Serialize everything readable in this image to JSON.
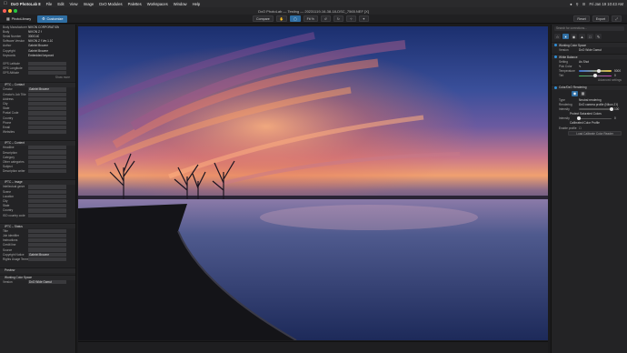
{
  "menubar": {
    "app_name": "DxO PhotoLab 8",
    "items": [
      "File",
      "Edit",
      "View",
      "Image",
      "DxO Modules",
      "Palettes",
      "Workspaces",
      "Window",
      "Help"
    ],
    "clock": "Fri Jan 19  10:43 AM"
  },
  "window": {
    "title": "DxO PhotoLab — Testing — 20231119-16-38-18-DSC_7565.NEF [X]"
  },
  "toolbar": {
    "tabs": [
      {
        "label": "PhotoLibrary",
        "active": false
      },
      {
        "label": "Customize",
        "active": true
      }
    ],
    "compare_label": "Compare",
    "zoom_label": "Fit %",
    "reset_label": "Reset",
    "export_label": "Export"
  },
  "left_panel": {
    "meta_rows": [
      {
        "key": "Body Manufacturer",
        "value": "NIKON CORPORATION"
      },
      {
        "key": "Body",
        "value": "NIKON Z f"
      },
      {
        "key": "Serial Number",
        "value": "3000140"
      },
      {
        "key": "Software Version",
        "value": "NIKON Z f Ver.1.10"
      },
      {
        "key": "Author",
        "value": "Gabriel Browne"
      },
      {
        "key": "Copyright",
        "value": "Gabriel Browne"
      },
      {
        "key": "Keywords",
        "value": "Embedded keyword"
      }
    ],
    "gps_rows": [
      {
        "key": "GPS Latitude",
        "value": ""
      },
      {
        "key": "GPS Longitude",
        "value": ""
      },
      {
        "key": "GPS Altitude",
        "value": ""
      }
    ],
    "show_more_label": "Show more",
    "sections": [
      {
        "title": "IPTC – Contact",
        "rows": [
          {
            "key": "Creator",
            "value": "Gabriel Browne"
          },
          {
            "key": "Creator's Job Title",
            "value": ""
          },
          {
            "key": "Address",
            "value": ""
          },
          {
            "key": "City",
            "value": ""
          },
          {
            "key": "State",
            "value": ""
          },
          {
            "key": "Postal Code",
            "value": ""
          },
          {
            "key": "Country",
            "value": ""
          },
          {
            "key": "Phone",
            "value": ""
          },
          {
            "key": "Email",
            "value": ""
          },
          {
            "key": "Websites",
            "value": ""
          }
        ]
      },
      {
        "title": "IPTC – Content",
        "rows": [
          {
            "key": "Headline",
            "value": ""
          },
          {
            "key": "Description",
            "value": ""
          },
          {
            "key": "Category",
            "value": ""
          },
          {
            "key": "Other categories",
            "value": ""
          },
          {
            "key": "Subject",
            "value": ""
          },
          {
            "key": "Description writer",
            "value": ""
          }
        ]
      },
      {
        "title": "IPTC – Image",
        "rows": [
          {
            "key": "Intellectual genre",
            "value": ""
          },
          {
            "key": "Scene",
            "value": ""
          },
          {
            "key": "Location",
            "value": ""
          },
          {
            "key": "City",
            "value": ""
          },
          {
            "key": "State",
            "value": ""
          },
          {
            "key": "Country",
            "value": ""
          },
          {
            "key": "ISO country code",
            "value": ""
          }
        ]
      },
      {
        "title": "IPTC – Status",
        "rows": [
          {
            "key": "Title",
            "value": ""
          },
          {
            "key": "Job identifier",
            "value": ""
          },
          {
            "key": "Instructions",
            "value": ""
          },
          {
            "key": "Credit line",
            "value": ""
          },
          {
            "key": "Source",
            "value": ""
          },
          {
            "key": "Copyright Notice",
            "value": "Gabriel Browne"
          },
          {
            "key": "Rights Usage Terms",
            "value": ""
          }
        ]
      }
    ],
    "footer_items": [
      "Preview",
      "Working Color Space"
    ],
    "footer_version_key": "Version",
    "footer_version_value": "DxO Wide Gamut"
  },
  "right_panel": {
    "search_placeholder": "Search for corrections...",
    "working_cs": {
      "title": "Working Color Space",
      "version_key": "Version",
      "version_value": "DxO Wide Gamut"
    },
    "white_balance": {
      "title": "White Balance",
      "setting_key": "Setting",
      "setting_value": "As Shot",
      "picker_key": "Pick Color",
      "temperature_key": "Temperature",
      "temperature_value": "5000",
      "temperature_level": 0.62,
      "tint_key": "Tint",
      "tint_value": "0",
      "tint_level": 0.5,
      "advanced_label": "Advanced settings"
    },
    "color_rendering": {
      "title": "Color/DxO Rendering",
      "type_key": "Type",
      "type_value": "Neutral rendering",
      "rendering_key": "Rendering",
      "rendering_value": "DxO camera profile (Nikon Z f)",
      "intensity_key": "Intensity",
      "intensity_value": "100",
      "intensity_level": 1.0,
      "protect_label": "Protect Saturated Colors",
      "protect_intensity_key": "Intensity",
      "protect_intensity_value": "0",
      "protect_level": 0.0
    },
    "calibrated": {
      "title": "Calibrated Color Profile",
      "enable_label": "Enable profile",
      "button_label": "Load Calibrate Color Reader"
    }
  },
  "colors": {
    "accent": "#2f6ea3",
    "panel_bg": "#232325",
    "app_bg": "#1b1b1d"
  }
}
